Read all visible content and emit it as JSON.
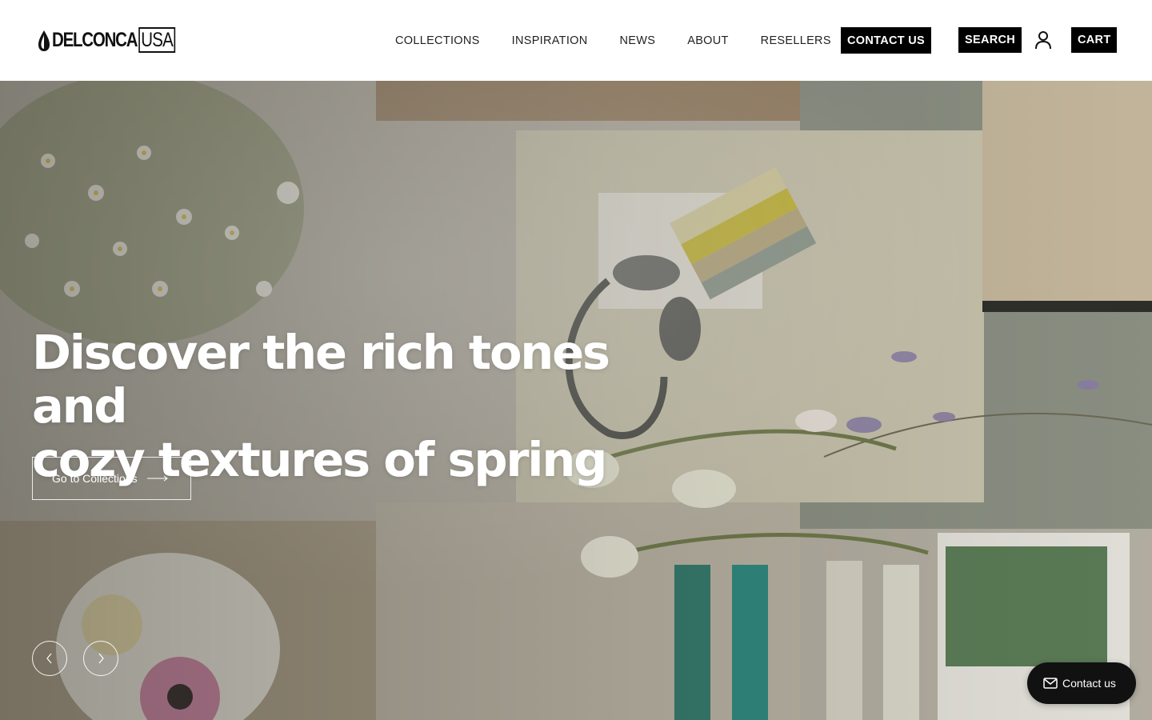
{
  "brand": {
    "logo_text": "DELCONCA",
    "logo_suffix": "USA"
  },
  "nav": {
    "items": [
      "COLLECTIONS",
      "INSPIRATION",
      "NEWS",
      "ABOUT",
      "RESELLERS"
    ],
    "contact_label": "CONTACT US",
    "search_label": "SEARCH",
    "cart_label": "CART"
  },
  "hero": {
    "headline_line1": "Discover the rich tones and",
    "headline_line2": "cozy textures of spring",
    "cta_label": "Go to Collections"
  },
  "floating": {
    "contact_label": "Contact us"
  },
  "icons": [
    "drop-logo-icon",
    "user-icon",
    "arrow-right-icon",
    "chevron-left-icon",
    "chevron-right-icon",
    "mail-icon"
  ],
  "colors": {
    "accent": "#000000",
    "text": "#222222",
    "hero_overlay": "#ffffff"
  }
}
